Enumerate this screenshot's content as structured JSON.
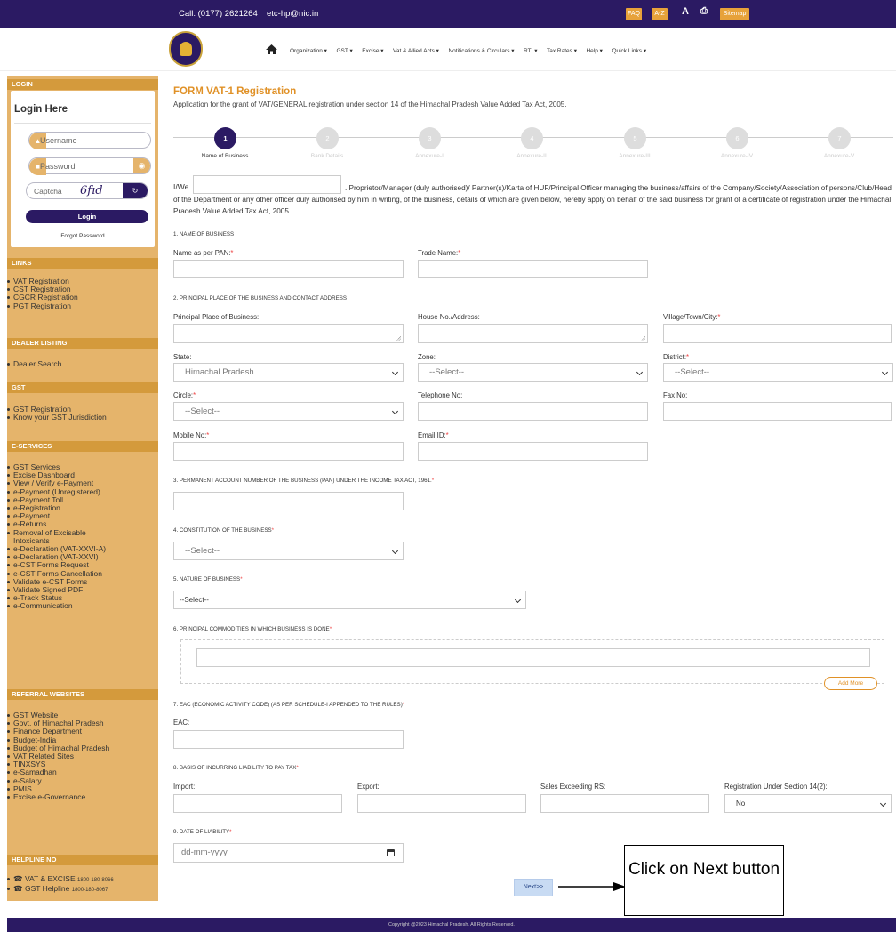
{
  "topbar": {
    "call": "Call: (0177) 2621264",
    "email": "etc-hp@nic.in",
    "faq": "FAQ",
    "az": "A-Z",
    "font": "A",
    "sitemap": "Sitemap"
  },
  "nav": [
    "Organization ▾",
    "GST ▾",
    "Excise ▾",
    "Vat & Allied Acts ▾",
    "Notifications & Circulars ▾",
    "RTI ▾",
    "Tax Rates ▾",
    "Help ▾",
    "Quick Links ▾"
  ],
  "login": {
    "section": "LOGIN",
    "title": "Login Here",
    "username": "Username",
    "password": "Password",
    "captcha_label": "Captcha",
    "captcha_text": "6fıd",
    "button": "Login",
    "forgot": "Forgot Password"
  },
  "links": {
    "section": "LINKS",
    "items": [
      "VAT Registration",
      "CST Registration",
      "CGCR Registration",
      "PGT Registration"
    ]
  },
  "dealer": {
    "section": "DEALER LISTING",
    "items": [
      "Dealer Search"
    ]
  },
  "gst": {
    "section": "GST",
    "items": [
      "GST Registration",
      "Know your GST Jurisdiction"
    ]
  },
  "eservices": {
    "section": "E-SERVICES",
    "items": [
      "GST Services",
      "Excise Dashboard",
      "View / Verify e-Payment",
      "e-Payment (Unregistered)",
      "e-Payment Toll",
      "e-Registration",
      "e-Payment",
      "e-Returns",
      "Removal of Excisable",
      "Intoxicants",
      "e-Declaration (VAT-XXVI-A)",
      "e-Declaration (VAT-XXVI)",
      "e-CST Forms Request",
      "e-CST Forms Cancellation",
      "Validate e-CST Forms",
      "Validate Signed PDF",
      "e-Track Status",
      "e-Communication"
    ]
  },
  "referral": {
    "section": "REFERRAL WEBSITES",
    "items": [
      "GST Website",
      "Govt. of Himachal Pradesh",
      "Finance Department",
      "Budget-India",
      "Budget of Himachal Pradesh",
      "VAT Related Sites",
      "TINXSYS",
      "e-Samadhan",
      "e-Salary",
      "PMIS",
      "Excise e-Governance"
    ]
  },
  "helpline": {
    "section": "HELPLINE NO",
    "items": [
      "VAT & EXCISE",
      "GST Helpline"
    ],
    "numbers": [
      "1800-180-8066",
      "1800-180-8067"
    ]
  },
  "form": {
    "title": "FORM VAT-1 Registration",
    "subtitle": "Application for the grant of VAT/GENERAL registration under section 14 of the Himachal Pradesh Value Added Tax Act, 2005.",
    "steps": [
      {
        "n": "1",
        "label": "Name of Business"
      },
      {
        "n": "2",
        "label": "Bank Details"
      },
      {
        "n": "3",
        "label": "Annexure-I"
      },
      {
        "n": "4",
        "label": "Annexure-II"
      },
      {
        "n": "5",
        "label": "Annexure-III"
      },
      {
        "n": "6",
        "label": "Annexure-IV"
      },
      {
        "n": "7",
        "label": "Annexure-V"
      }
    ],
    "iwe": "I/We",
    "declaration": ". Proprietor/Manager (duly authorised)/ Partner(s)/Karta of HUF/Principal Officer managing the business/affairs of the Company/Society/Association of persons/Club/Head of the Department or any other officer duly authorised by him in writing, of the business, details of which are given below, hereby apply on behalf of the said business for grant of a certificate of registration under the Himachal Pradesh Value Added Tax Act, 2005",
    "s1": "1. NAME OF BUSINESS",
    "name_pan": "Name as per PAN:",
    "trade_name": "Trade Name:",
    "s2": "2. PRINCIPAL PLACE OF THE BUSINESS AND CONTACT ADDRESS",
    "ppb": "Principal Place of Business:",
    "house": "House No./Address:",
    "village": "Village/Town/City:",
    "state": "State:",
    "state_val": "Himachal Pradesh",
    "zone": "Zone:",
    "zone_val": "--Select--",
    "district": "District:",
    "district_val": "--Select--",
    "circle": "Circle:",
    "circle_val": "--Select--",
    "telephone": "Telephone No:",
    "fax": "Fax No:",
    "mobile": "Mobile No:",
    "email": "Email ID:",
    "s3": "3. PERMANENT ACCOUNT NUMBER OF THE BUSINESS (PAN) UNDER THE INCOME TAX ACT, 1961.",
    "s4": "4. CONSTITUTION OF THE BUSINESS",
    "constitution_val": "--Select--",
    "s5": "5. NATURE OF BUSINESS",
    "nature_val": "--Select--",
    "s6": "6. PRINCIPAL COMMODITIES IN WHICH BUSINESS IS DONE",
    "add_more": "Add More",
    "s7": "7. EAC (ECONOMIC ACTIVITY CODE) (AS PER SCHEDULE-I APPENDED TO THE RULES)",
    "eac": "EAC:",
    "s8": "8. BASIS OF INCURRING LIABILITY TO PAY TAX",
    "import": "Import:",
    "export": "Export:",
    "sales": "Sales Exceeding RS:",
    "reg14": "Registration Under Section 14(2):",
    "reg14_val": "No",
    "s9": "9. DATE OF LIABILITY",
    "date_placeholder": "dd-mm-yyyy",
    "next": "Next>>"
  },
  "callout": "Click on Next button",
  "footer": "Copyright @2023 Himachal Pradesh. All Rights Reserved.",
  "colors": {
    "primary": "#2b1a63",
    "accent": "#e09127",
    "sidebar": "#e5b46b"
  }
}
